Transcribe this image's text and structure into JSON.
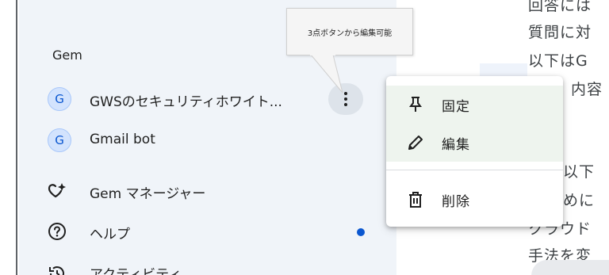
{
  "tooltip": {
    "text": "3点ボタンから編集可能"
  },
  "sidebar": {
    "section_title": "Gem",
    "gems": [
      {
        "initial": "G",
        "label": "GWSのセキュリティホワイト..."
      },
      {
        "initial": "G",
        "label": "Gmail bot"
      }
    ],
    "nav": [
      {
        "icon": "gem-manager-icon",
        "label": "Gem マネージャー"
      },
      {
        "icon": "help-icon",
        "label": "ヘルプ"
      },
      {
        "icon": "activity-icon",
        "label": "アクティビティ"
      }
    ]
  },
  "menu": {
    "items": [
      {
        "icon": "pin-icon",
        "label": "固定"
      },
      {
        "icon": "pencil-icon",
        "label": "編集"
      },
      {
        "icon": "trash-icon",
        "label": "削除"
      }
    ]
  },
  "main": {
    "lines": [
      "回答には",
      "質問に対",
      "以下はG",
      "内容",
      "以下",
      "めに",
      "クラウド",
      "手法を変"
    ]
  },
  "colors": {
    "sidebar_bg": "#f0f4f9",
    "accent": "#0b57d0",
    "avatar_bg": "#d3e3fd"
  }
}
